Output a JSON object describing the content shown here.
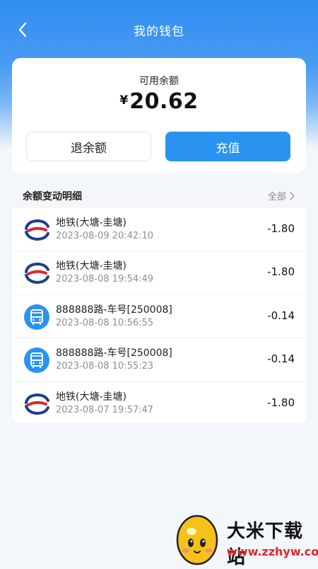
{
  "header": {
    "title": "我的钱包"
  },
  "balance": {
    "label": "可用余额",
    "currency": "¥",
    "amount": "20.62"
  },
  "actions": {
    "refund_label": "退余额",
    "recharge_label": "充值"
  },
  "records": {
    "title": "余额变动明细",
    "all_label": "全部",
    "items": [
      {
        "icon": "metro-logo-icon",
        "name": "地铁(大塘-圭塘)",
        "time": "2023-08-09 20:42:10",
        "amount": "-1.80"
      },
      {
        "icon": "metro-logo-icon",
        "name": "地铁(大塘-圭塘)",
        "time": "2023-08-08 19:54:49",
        "amount": "-1.80"
      },
      {
        "icon": "bus-icon",
        "name": "888888路-车号[250008]",
        "time": "2023-08-08 10:56:55",
        "amount": "-0.14"
      },
      {
        "icon": "bus-icon",
        "name": "888888路-车号[250008]",
        "time": "2023-08-08 10:55:23",
        "amount": "-0.14"
      },
      {
        "icon": "metro-logo-icon",
        "name": "地铁(大塘-圭塘)",
        "time": "2023-08-07 19:57:47",
        "amount": "-1.80"
      }
    ]
  },
  "watermark": {
    "title": "大米下载站",
    "url": "www.zzhyw.com"
  },
  "colors": {
    "primary": "#2a93f0",
    "metro_red": "#e0262c",
    "metro_blue": "#1f3f8f",
    "bus_blue": "#2a93f0"
  }
}
